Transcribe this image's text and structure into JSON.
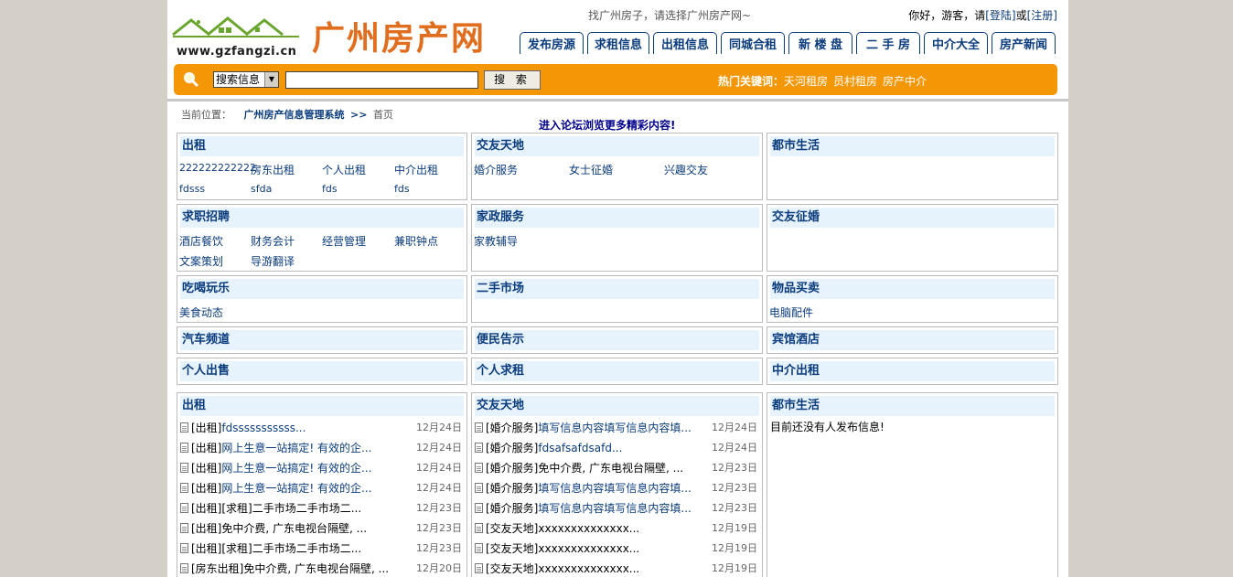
{
  "header": {
    "logo_url": "www.gzfangzi.cn",
    "logo_text": "广州房产网",
    "slogan": "找广州房子，请选择广州房产网~",
    "greeting": "你好，游客，请",
    "login": "[登陆]",
    "or": "或",
    "register": "[注册]"
  },
  "nav": [
    "发布房源",
    "求租信息",
    "出租信息",
    "同城合租",
    "新 楼 盘",
    "二 手 房",
    "中介大全",
    "房产新闻"
  ],
  "search": {
    "select_value": "搜索信息",
    "button": "搜 索",
    "hot_label": "热门关键词：",
    "hot_keywords": [
      "天河租房",
      "员村租房",
      "房产中介"
    ]
  },
  "breadcrumb": {
    "label": "当前位置：",
    "site": "广州房产信息管理系统",
    "sep": ">>",
    "current": "首页"
  },
  "forum_link": "进入论坛浏览更多精彩内容!",
  "categories": [
    {
      "title": "出租",
      "items": [
        "222222222222",
        "房东出租",
        "个人出租",
        "中介出租",
        "fdsss",
        "sfda",
        "fds",
        "fds"
      ]
    },
    {
      "title": "交友天地",
      "items": [
        "婚介服务",
        "女士征婚",
        "兴趣交友"
      ]
    },
    {
      "title": "都市生活",
      "items": []
    },
    {
      "title": "求职招聘",
      "items": [
        "酒店餐饮",
        "财务会计",
        "经营管理",
        "兼职钟点",
        "文案策划",
        "导游翻译"
      ]
    },
    {
      "title": "家政服务",
      "items": [
        "家教辅导"
      ]
    },
    {
      "title": "交友征婚",
      "items": []
    },
    {
      "title": "吃喝玩乐",
      "items": [
        "美食动态"
      ]
    },
    {
      "title": "二手市场",
      "items": []
    },
    {
      "title": "物品买卖",
      "items": [
        "电脑配件"
      ]
    },
    {
      "title": "汽车频道",
      "items": []
    },
    {
      "title": "便民告示",
      "items": []
    },
    {
      "title": "宾馆酒店",
      "items": []
    },
    {
      "title": "个人出售",
      "items": []
    },
    {
      "title": "个人求租",
      "items": []
    },
    {
      "title": "中介出租",
      "items": []
    }
  ],
  "lists": [
    {
      "title": "出租",
      "rows": [
        {
          "prefix": "[出租]",
          "text": "fdsssssssssss...",
          "date": "12月24日"
        },
        {
          "prefix": "[出租]",
          "text": "网上生意一站搞定! 有效的企...",
          "date": "12月24日"
        },
        {
          "prefix": "[出租]",
          "text": "网上生意一站搞定! 有效的企...",
          "date": "12月24日"
        },
        {
          "prefix": "[出租]",
          "text": "网上生意一站搞定! 有效的企...",
          "date": "12月24日"
        },
        {
          "prefix": "[出租]",
          "text": "[求租]二手市场二手市场二...",
          "date": "12月23日"
        },
        {
          "prefix": "[出租]",
          "text": "免中介费, 广东电视台隔壁, ...",
          "date": "12月23日"
        },
        {
          "prefix": "[出租]",
          "text": "[求租]二手市场二手市场二...",
          "date": "12月23日"
        },
        {
          "prefix": "[房东出租]",
          "text": "免中介费, 广东电视台隔壁, ...",
          "date": "12月20日"
        }
      ]
    },
    {
      "title": "交友天地",
      "rows": [
        {
          "prefix": "[婚介服务]",
          "text": "填写信息内容填写信息内容填...",
          "date": "12月24日"
        },
        {
          "prefix": "[婚介服务]",
          "text": "fdsafsafdsafd...",
          "date": "12月24日"
        },
        {
          "prefix": "[婚介服务]",
          "text": "免中介费, 广东电视台隔壁, ...",
          "date": "12月23日"
        },
        {
          "prefix": "[婚介服务]",
          "text": "填写信息内容填写信息内容填...",
          "date": "12月23日"
        },
        {
          "prefix": "[婚介服务]",
          "text": "填写信息内容填写信息内容填...",
          "date": "12月23日"
        },
        {
          "prefix": "[交友天地]",
          "text": "xxxxxxxxxxxxxx...",
          "date": "12月19日"
        },
        {
          "prefix": "[交友天地]",
          "text": "xxxxxxxxxxxxxx...",
          "date": "12月19日"
        },
        {
          "prefix": "[交友天地]",
          "text": "xxxxxxxxxxxxxx...",
          "date": "12月19日"
        }
      ]
    },
    {
      "title": "都市生活",
      "empty": "目前还没有人发布信息!",
      "rows": []
    }
  ],
  "colors": {
    "accent": "#f39706",
    "link": "#0b3c7d",
    "header_bg": "#e6f2fc",
    "logo": "#e06e1e"
  }
}
